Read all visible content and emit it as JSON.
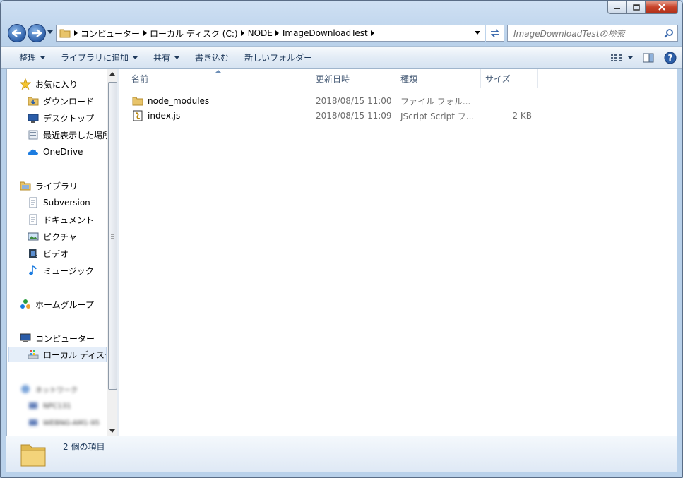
{
  "window": {
    "caption_buttons": [
      "minimize",
      "maximize",
      "close"
    ]
  },
  "address": {
    "crumbs": [
      "コンピューター",
      "ローカル ディスク (C:)",
      "NODE",
      "ImageDownloadTest"
    ]
  },
  "search": {
    "placeholder": "ImageDownloadTestの検索"
  },
  "toolbar": {
    "organize": "整理",
    "add_to_library": "ライブラリに追加",
    "share": "共有",
    "burn": "書き込む",
    "new_folder": "新しいフォルダー"
  },
  "nav": {
    "favorites": {
      "label": "お気に入り",
      "items": [
        {
          "label": "ダウンロード",
          "icon": "downloads-folder-icon"
        },
        {
          "label": "デスクトップ",
          "icon": "desktop-icon"
        },
        {
          "label": "最近表示した場所",
          "icon": "recent-places-icon"
        },
        {
          "label": "OneDrive",
          "icon": "onedrive-cloud-icon"
        }
      ]
    },
    "libraries": {
      "label": "ライブラリ",
      "items": [
        {
          "label": "Subversion",
          "icon": "document-library-icon"
        },
        {
          "label": "ドキュメント",
          "icon": "document-library-icon"
        },
        {
          "label": "ピクチャ",
          "icon": "pictures-icon"
        },
        {
          "label": "ビデオ",
          "icon": "video-icon"
        },
        {
          "label": "ミュージック",
          "icon": "music-note-icon"
        }
      ]
    },
    "homegroup": {
      "label": "ホームグループ"
    },
    "computer": {
      "label": "コンピューター",
      "items": [
        {
          "label": "ローカル ディスク (C:)",
          "icon": "local-disk-icon",
          "selected": true
        }
      ]
    },
    "network": {
      "label": "ネットワーク",
      "items": [
        {
          "label": "NPC131"
        },
        {
          "label": "WEBNG-AM1-95"
        }
      ]
    }
  },
  "columns": {
    "name": "名前",
    "date": "更新日時",
    "type": "種類",
    "size": "サイズ"
  },
  "files": [
    {
      "name": "node_modules",
      "date": "2018/08/15 11:00",
      "type": "ファイル フォル...",
      "size": "",
      "icon": "folder-icon"
    },
    {
      "name": "index.js",
      "date": "2018/08/15 11:09",
      "type": "JScript Script フ...",
      "size": "2 KB",
      "icon": "jscript-file-icon"
    }
  ],
  "details": {
    "item_count": "2 個の項目"
  }
}
